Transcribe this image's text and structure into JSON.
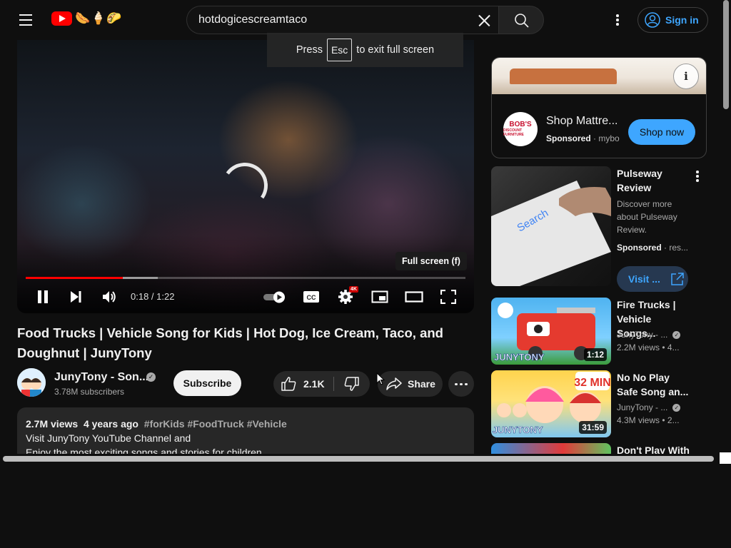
{
  "masthead": {
    "search_value": "hotdogicescreamtaco",
    "signin_label": "Sign in",
    "doodle_icons": [
      "hot-dog-icon",
      "ice-cream-icon",
      "taco-icon"
    ]
  },
  "fullscreen_toast": {
    "press": "Press",
    "key": "Esc",
    "suffix": "to exit full screen"
  },
  "player": {
    "tooltip": "Full screen (f)",
    "time": "0:18 / 1:22",
    "progress_played_fraction": 0.22,
    "progress_buffered_fraction": 0.3,
    "settings_badge": "4K"
  },
  "video": {
    "title": "Food Trucks | Vehicle Song for Kids | Hot Dog, Ice Cream, Taco, and Doughnut | JunyTony",
    "channel": {
      "name": "JunyTony - Son...",
      "subscribers": "3.78M subscribers",
      "subscribe_label": "Subscribe"
    },
    "likes": "2.1K",
    "share_label": "Share",
    "description": {
      "views": "2.7M views",
      "age": "4 years ago",
      "tags": "#forKids #FoodTruck #Vehicle",
      "line1": "Visit JunyTony YouTube Channel and",
      "line2": "Enjoy the most exciting songs and stories for children"
    }
  },
  "sidebar": {
    "ad": {
      "title": "Shop Mattre...",
      "sponsored": "Sponsored",
      "domain": "mybo",
      "cta": "Shop now",
      "logo_line1": "BOB'S",
      "logo_line2": "DISCOUNT FURNITURE"
    },
    "sponsored_video": {
      "title": "Pulseway Review",
      "desc": "Discover more about Pulseway Review.",
      "sponsored": "Sponsored",
      "source": "res...",
      "cta": "Visit ...",
      "thumb_text": "Search"
    },
    "recommendations": [
      {
        "title": "Fire Trucks | Vehicle Songs...",
        "channel": "JunyTony - ...",
        "stats": "2.2M views",
        "age": "4...",
        "duration": "1:12",
        "thumb_label": "JUNYTONY"
      },
      {
        "title": "No No Play Safe Song an...",
        "channel": "JunyTony - ...",
        "stats": "4.3M views",
        "age": "2...",
        "duration": "31:59",
        "thumb_label": "JUNYTONY",
        "badge": "32 MIN"
      },
      {
        "title": "Don't Play With"
      }
    ]
  },
  "colors": {
    "background": "#0f0f0f",
    "accent_blue": "#3ea6ff",
    "progress_red": "#ff0000",
    "chip": "#272727"
  }
}
